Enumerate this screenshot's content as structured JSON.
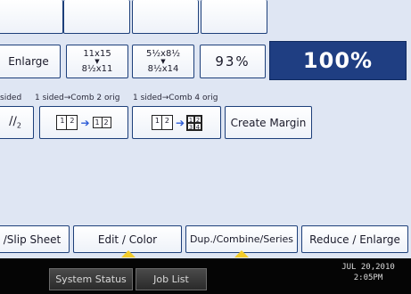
{
  "size_row": {
    "enlarge_label": "Enlarge",
    "size1_top": "11x15",
    "size1_bottom": "8½x11",
    "size2_top": "5½x8½",
    "size2_bottom": "8½x14",
    "pct_value": "93%",
    "selected_ratio": "100%"
  },
  "combine": {
    "group_label_1": "sided",
    "group_label_2": "1 sided→Comb 2 orig",
    "group_label_3": "1 sided→Comb 4 orig",
    "create_margin_label": "Create Margin",
    "p1": "1",
    "p2": "2",
    "p3": "3",
    "p4": "4"
  },
  "tabs": {
    "slip_sheet": "/Slip Sheet",
    "edit_color": "Edit / Color",
    "dup_combine": "Dup./Combine/Series",
    "reduce_enlarge": "Reduce / Enlarge"
  },
  "footer": {
    "system_status": "System Status",
    "job_list": "Job List",
    "date": "JUL  20,2010",
    "time": "2:05PM"
  },
  "colors": {
    "panel_bg": "#dfe6f3",
    "selected_bg": "#1f3e82",
    "tab_indicator": "#f3cc2a",
    "footer_bg": "#050505"
  }
}
